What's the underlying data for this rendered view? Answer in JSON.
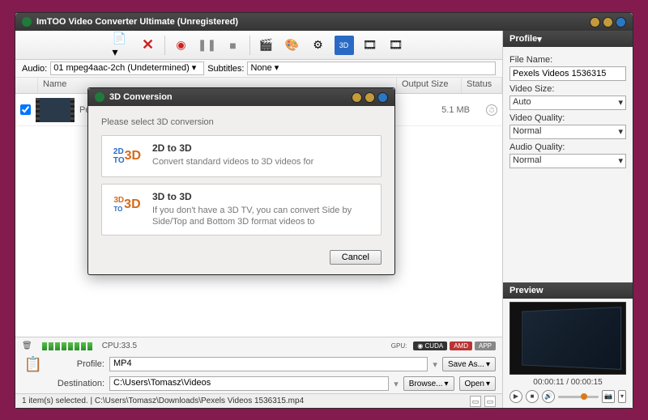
{
  "window": {
    "title": "ImTOO Video Converter Ultimate (Unregistered)"
  },
  "audio_row": {
    "audio_label": "Audio:",
    "audio_value": "01 mpeg4aac-2ch (Undetermined)",
    "subtitles_label": "Subtitles:",
    "subtitles_value": "None"
  },
  "list": {
    "col_name": "Name",
    "col_output_size": "Output Size",
    "col_status": "Status",
    "rows": [
      {
        "name": "Pe",
        "output_size": "5.1 MB"
      }
    ]
  },
  "cpu_row": {
    "cpu_label": "CPU:33.5",
    "gpu_label": "GPU:"
  },
  "profile_row": {
    "profile_label": "Profile:",
    "profile_value": "MP4",
    "save_as": "Save As...",
    "dest_label": "Destination:",
    "dest_value": "C:\\Users\\Tomasz\\Videos",
    "browse": "Browse...",
    "open": "Open"
  },
  "statusbar": {
    "text": "1 item(s) selected. | C:\\Users\\Tomasz\\Downloads\\Pexels Videos 1536315.mp4"
  },
  "right": {
    "profile_header": "Profile",
    "filename_label": "File Name:",
    "filename_value": "Pexels Videos 1536315",
    "videosize_label": "Video Size:",
    "videosize_value": "Auto",
    "vq_label": "Video Quality:",
    "vq_value": "Normal",
    "aq_label": "Audio Quality:",
    "aq_value": "Normal",
    "preview_header": "Preview",
    "time": "00:00:11 / 00:00:15"
  },
  "modal": {
    "title": "3D Conversion",
    "prompt": "Please select 3D conversion",
    "opt1_title": "2D to 3D",
    "opt1_desc": "Convert standard videos to 3D videos for",
    "opt2_title": "3D to 3D",
    "opt2_desc": "If you don't have a 3D TV, you can convert Side by Side/Top and Bottom 3D format videos to",
    "cancel": "Cancel"
  }
}
